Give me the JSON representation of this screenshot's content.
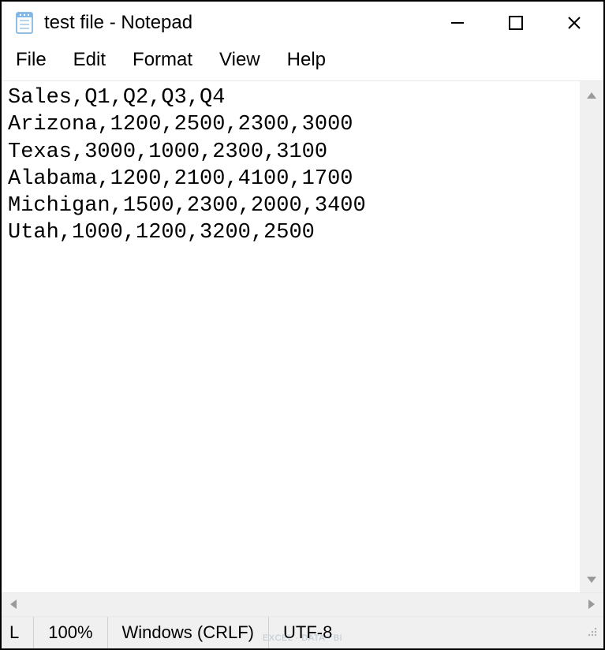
{
  "titlebar": {
    "title": "test file - Notepad"
  },
  "menu": {
    "file": "File",
    "edit": "Edit",
    "format": "Format",
    "view": "View",
    "help": "Help"
  },
  "content": {
    "text": "Sales,Q1,Q2,Q3,Q4\nArizona,1200,2500,2300,3000\nTexas,3000,1000,2300,3100\nAlabama,1200,2100,4100,1700\nMichigan,1500,2300,2000,3400\nUtah,1000,1200,3200,2500"
  },
  "statusbar": {
    "line_col_prefix": "L",
    "zoom": "100%",
    "line_ending": "Windows (CRLF)",
    "encoding": "UTF-8"
  },
  "watermark": "EXCEL · DATA · BI"
}
